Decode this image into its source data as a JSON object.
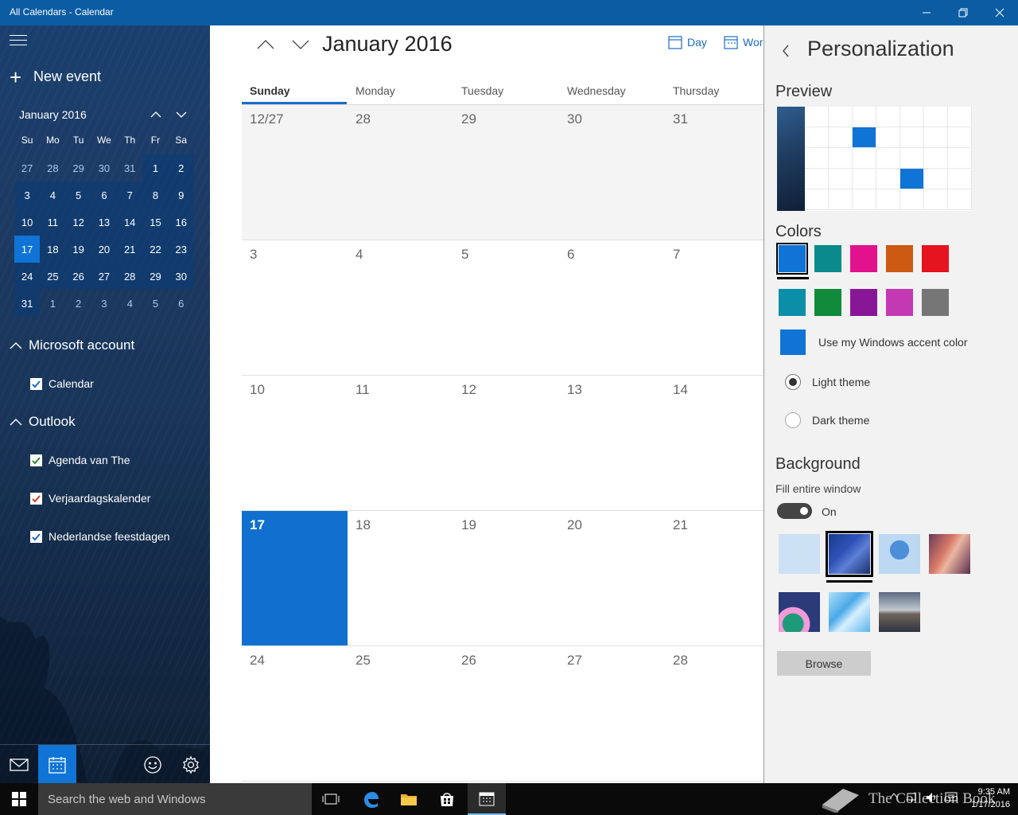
{
  "window": {
    "title": "All Calendars - Calendar"
  },
  "sidebar": {
    "new_event": "New event",
    "mini_calendar": {
      "title": "January 2016",
      "dow": [
        "Su",
        "Mo",
        "Tu",
        "We",
        "Th",
        "Fr",
        "Sa"
      ],
      "weeks": [
        [
          "27",
          "28",
          "29",
          "30",
          "31",
          "1",
          "2"
        ],
        [
          "3",
          "4",
          "5",
          "6",
          "7",
          "8",
          "9"
        ],
        [
          "10",
          "11",
          "12",
          "13",
          "14",
          "15",
          "16"
        ],
        [
          "17",
          "18",
          "19",
          "20",
          "21",
          "22",
          "23"
        ],
        [
          "24",
          "25",
          "26",
          "27",
          "28",
          "29",
          "30"
        ],
        [
          "31",
          "1",
          "2",
          "3",
          "4",
          "5",
          "6"
        ]
      ],
      "today": "17"
    },
    "groups": [
      {
        "label": "Microsoft account",
        "calendars": [
          {
            "label": "Calendar",
            "color": "#1a6cc9"
          }
        ]
      },
      {
        "label": "Outlook",
        "calendars": [
          {
            "label": "Agenda van The",
            "color": "#2e8b3a"
          },
          {
            "label": "Verjaardagskalender",
            "color": "#d13a2a"
          },
          {
            "label": "Nederlandse feestdagen",
            "color": "#1a6cc9"
          }
        ]
      }
    ]
  },
  "main": {
    "month_title": "January 2016",
    "views": {
      "day": "Day",
      "work_week": "Wor"
    },
    "dow": [
      "Sunday",
      "Monday",
      "Tuesday",
      "Wednesday",
      "Thursday"
    ],
    "weeks": [
      [
        "12/27",
        "28",
        "29",
        "30",
        "31"
      ],
      [
        "3",
        "4",
        "5",
        "6",
        "7"
      ],
      [
        "10",
        "11",
        "12",
        "13",
        "14"
      ],
      [
        "17",
        "18",
        "19",
        "20",
        "21"
      ],
      [
        "24",
        "25",
        "26",
        "27",
        "28"
      ]
    ],
    "today": "17"
  },
  "panel": {
    "title": "Personalization",
    "preview_heading": "Preview",
    "colors_heading": "Colors",
    "colors": [
      "#0f74d6",
      "#0a8a8a",
      "#e2128c",
      "#cc5a12",
      "#e5141f",
      "#0b8fa8",
      "#128a3c",
      "#881798",
      "#c239b3",
      "#767676"
    ],
    "selected_color": "#0f74d6",
    "accent_label": "Use my Windows accent color",
    "light_theme": "Light theme",
    "dark_theme": "Dark theme",
    "selected_theme": "Light theme",
    "background_heading": "Background",
    "fill_label": "Fill entire window",
    "toggle_state": "On",
    "browse": "Browse"
  },
  "taskbar": {
    "search_placeholder": "Search the web and Windows",
    "time": "9:35 AM",
    "date": "1/17/2016",
    "watermark": "The Collection Book"
  }
}
